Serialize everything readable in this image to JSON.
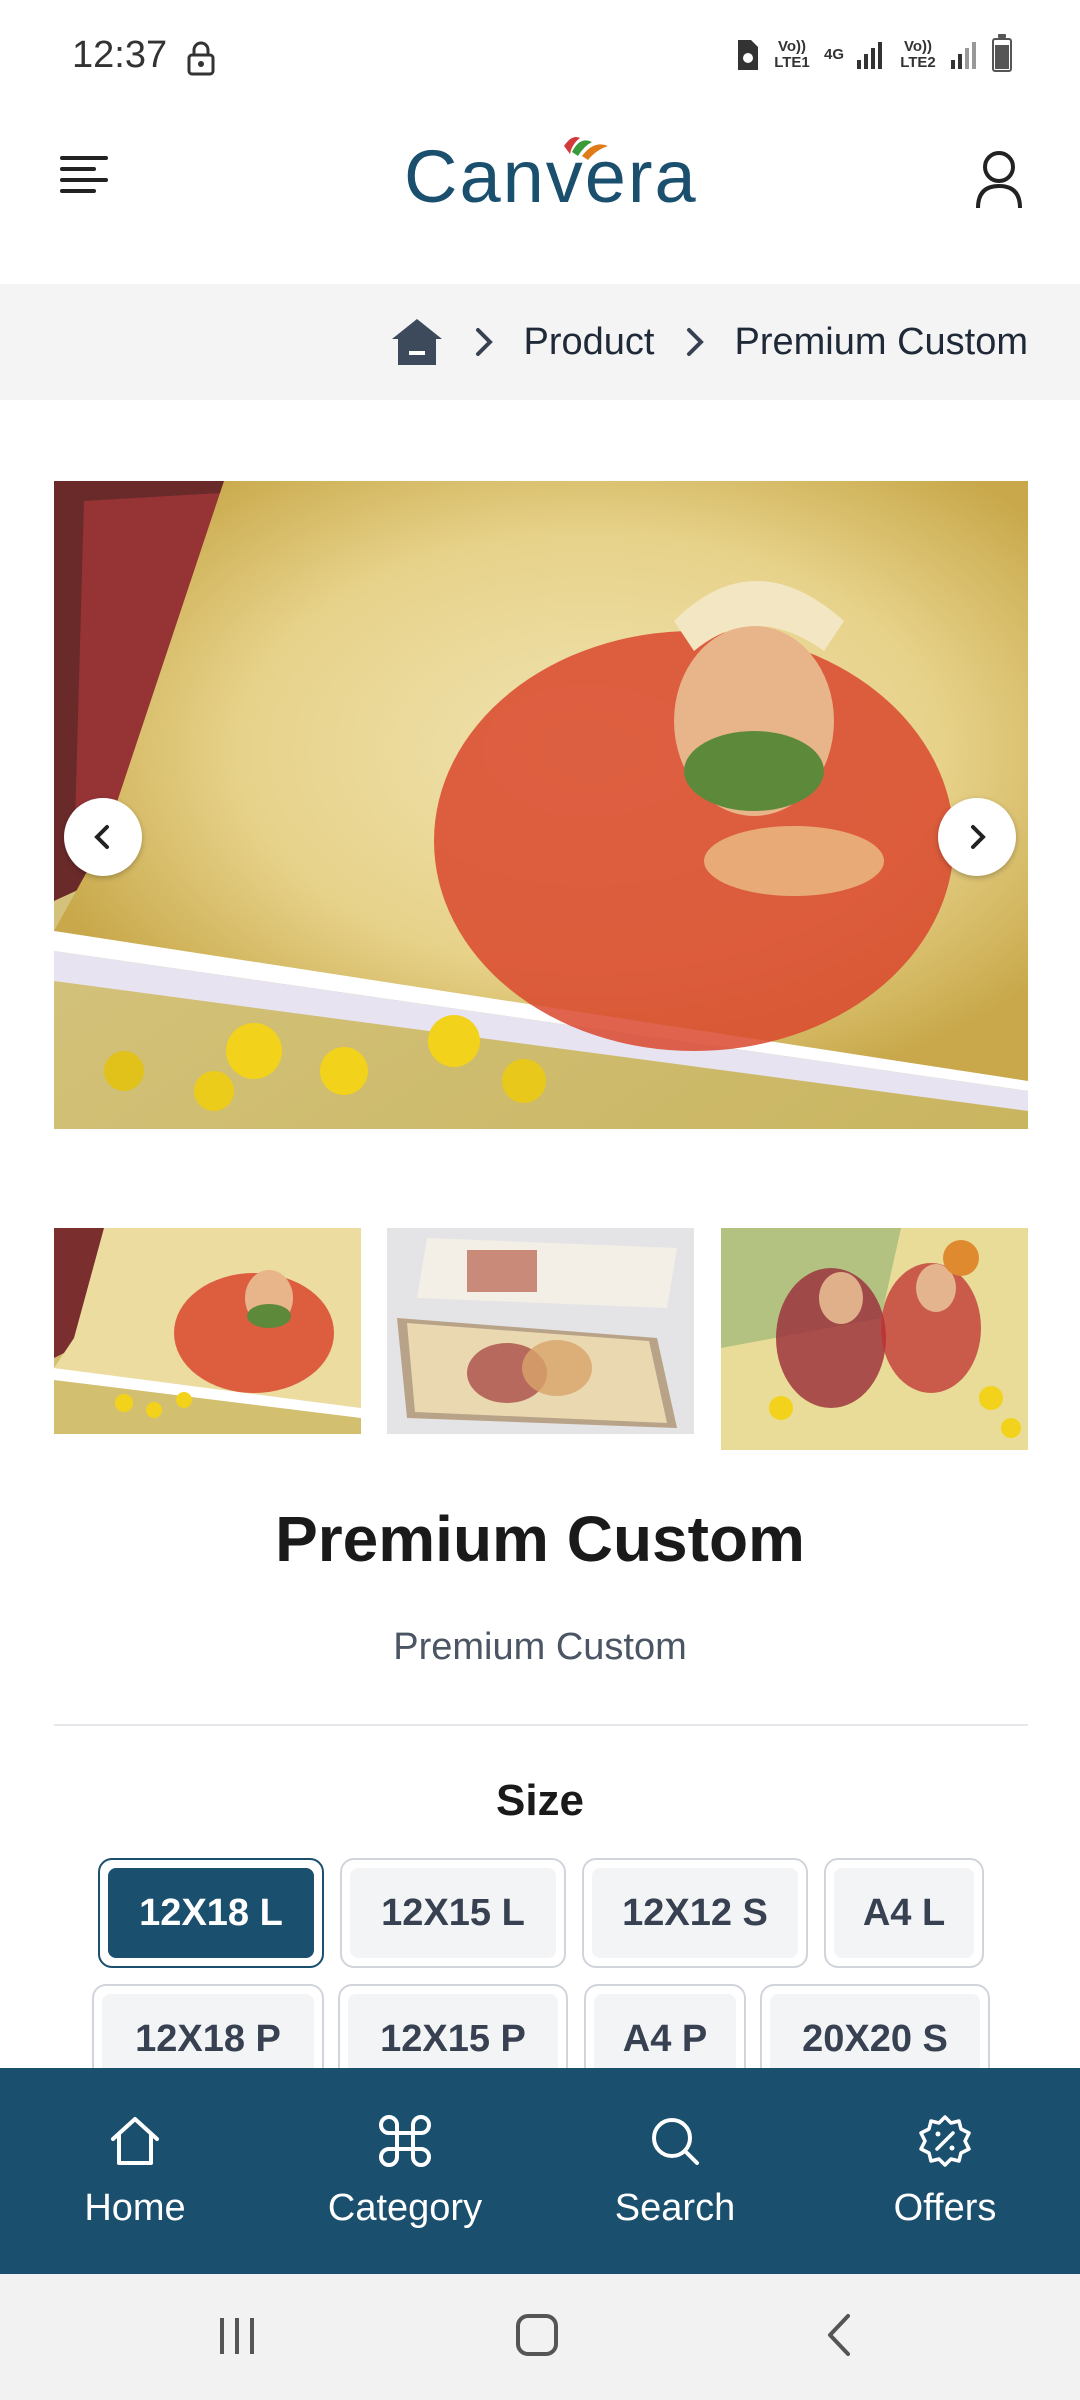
{
  "status_bar": {
    "time": "12:37",
    "sim1": "Vo)) LTE1",
    "net": "4G",
    "sim2": "Vo)) LTE2"
  },
  "header": {
    "logo_text": "Canvera",
    "brand_color": "#1a4f6e"
  },
  "breadcrumb": {
    "items": [
      "Product",
      "Premium Custom"
    ]
  },
  "product": {
    "title": "Premium Custom",
    "subtitle": "Premium Custom"
  },
  "size": {
    "label": "Size",
    "selected": "12X18 L",
    "options": [
      "12X18 L",
      "12X15 L",
      "12X12 S",
      "A4 L",
      "12X18 P",
      "12X15 P",
      "A4 P",
      "20X20 S"
    ]
  },
  "bottom_nav": {
    "items": [
      {
        "label": "Home",
        "icon": "home-icon"
      },
      {
        "label": "Category",
        "icon": "command-icon"
      },
      {
        "label": "Search",
        "icon": "search-icon"
      },
      {
        "label": "Offers",
        "icon": "badge-percent-icon"
      }
    ]
  },
  "colors": {
    "accent": "#1a4f6e",
    "logo_leaf_green": "#3a9b3a",
    "logo_leaf_orange": "#e07b1a"
  }
}
